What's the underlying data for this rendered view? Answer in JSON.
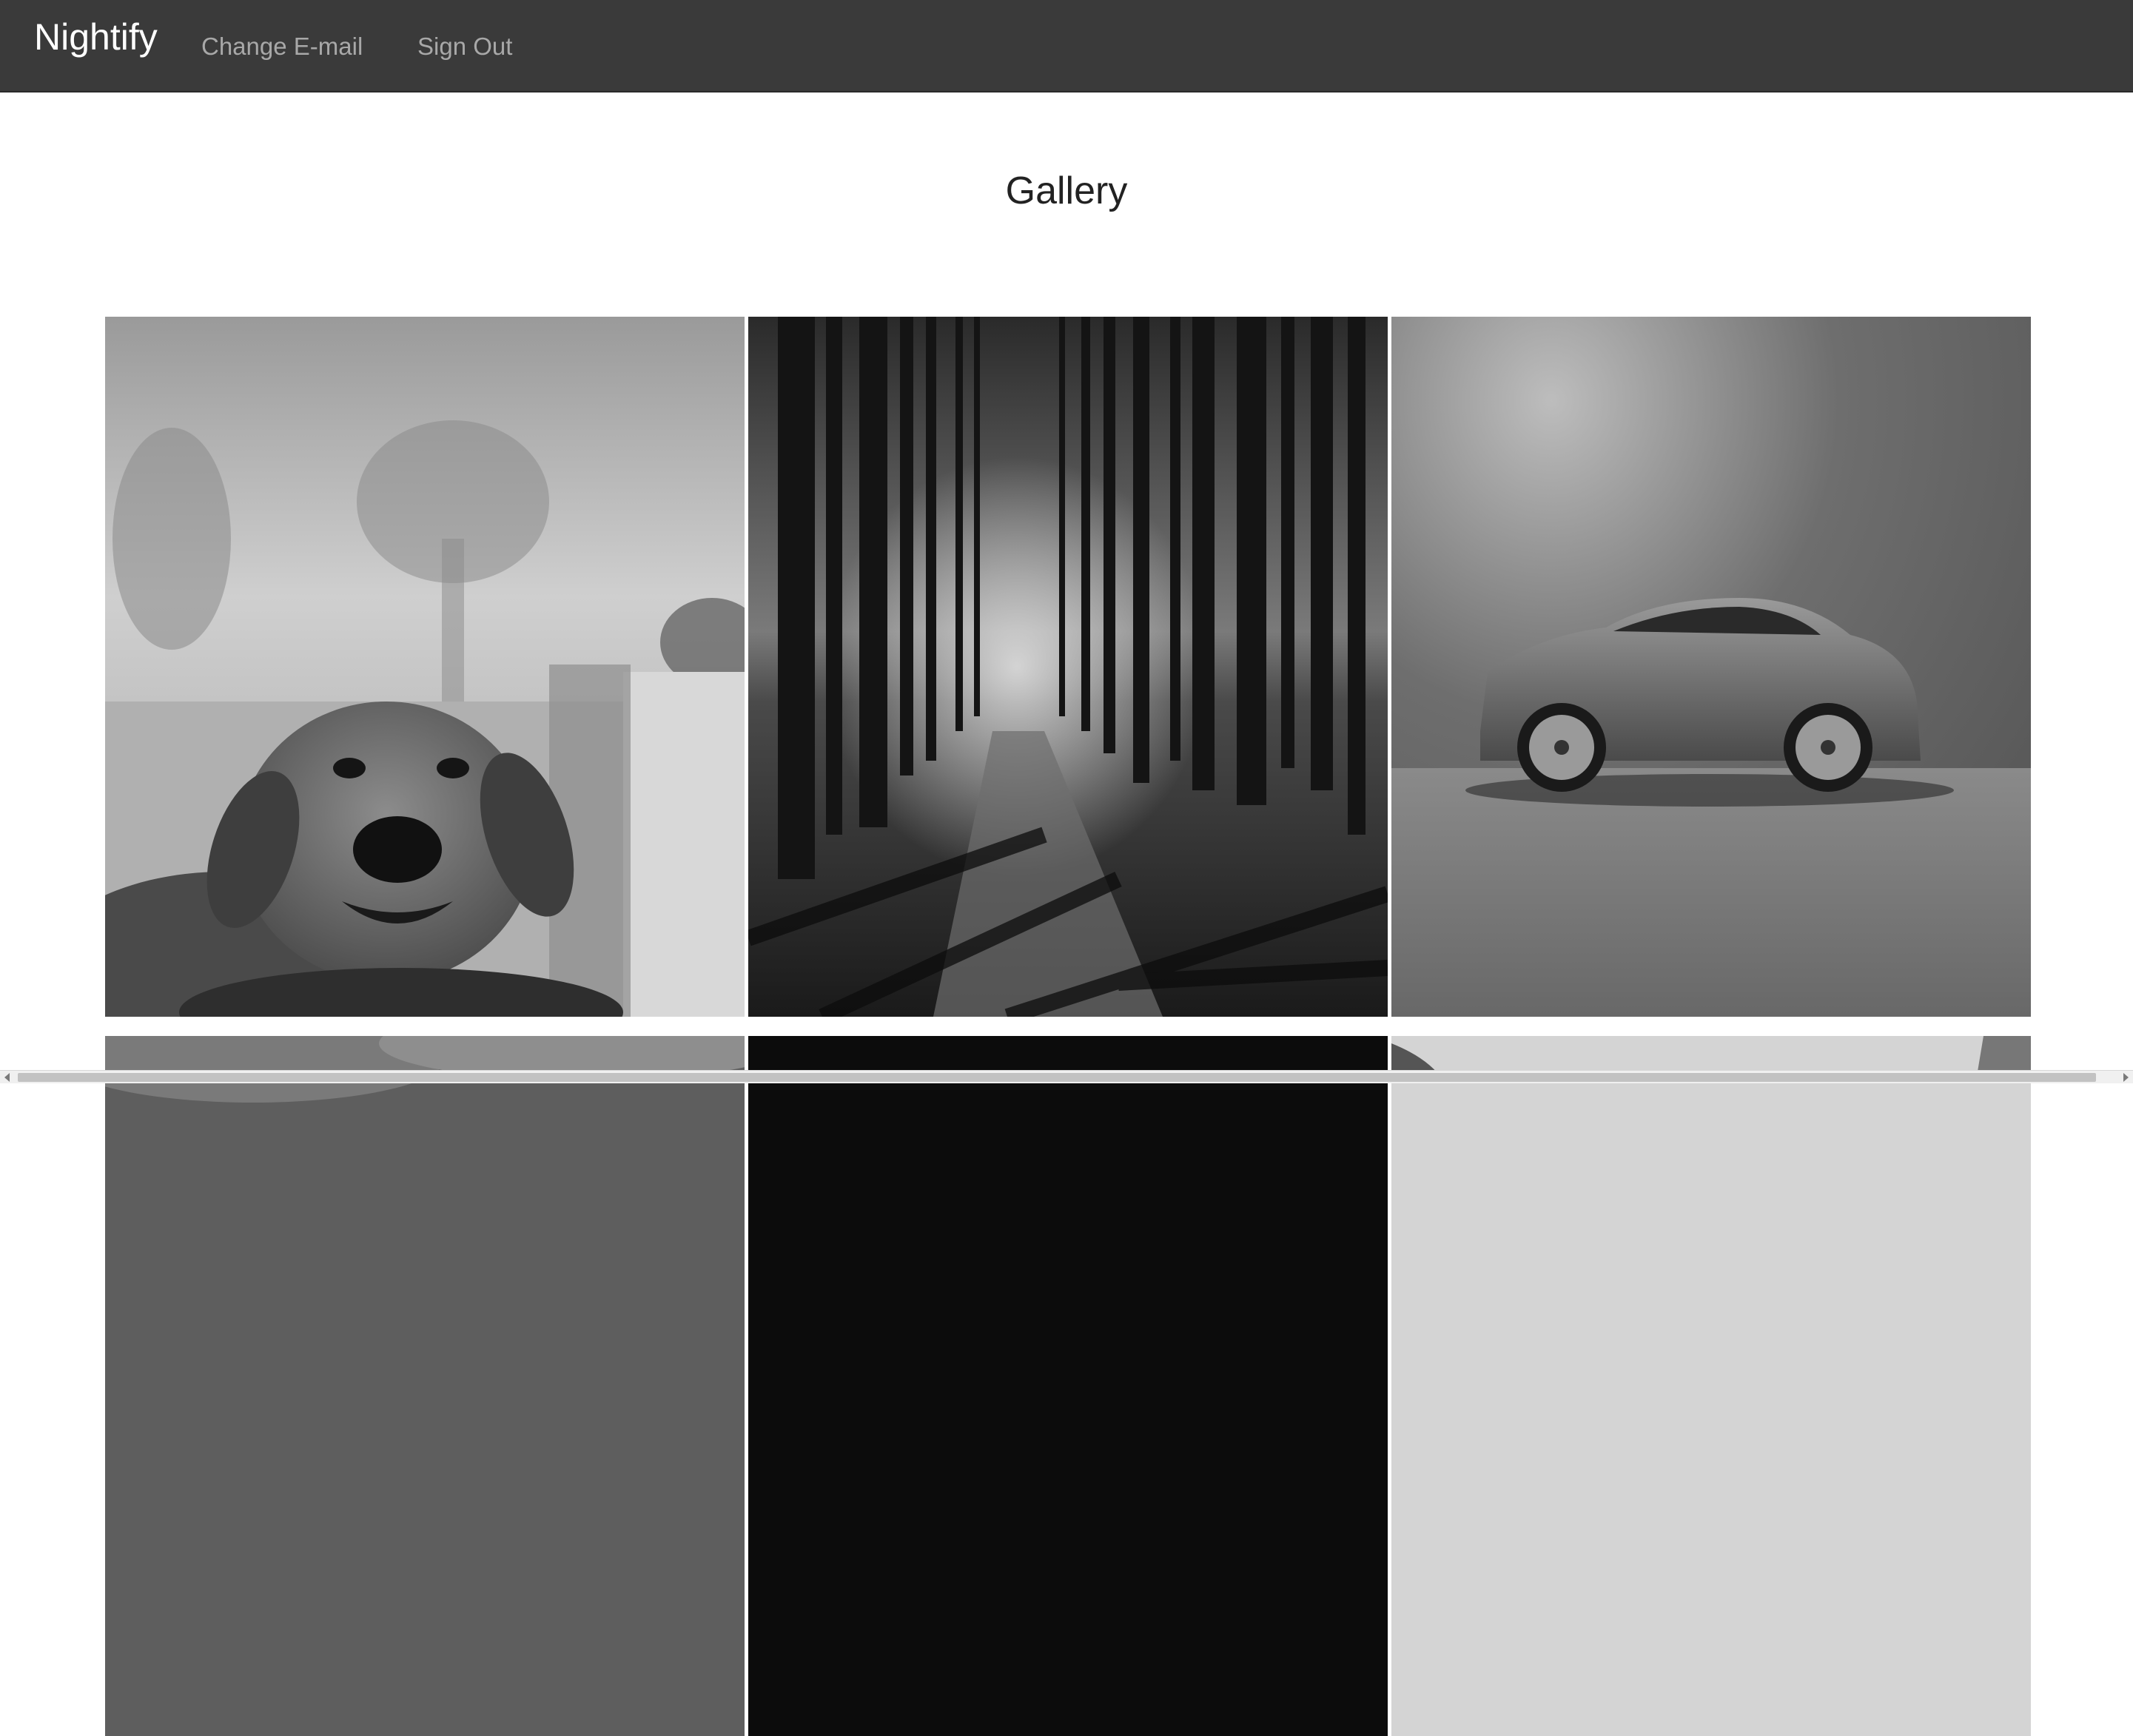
{
  "navbar": {
    "brand": "Nightify",
    "links": [
      {
        "label": "Change E-mail"
      },
      {
        "label": "Sign Out"
      }
    ]
  },
  "page": {
    "title": "Gallery"
  },
  "gallery": {
    "images": [
      {
        "subject": "golden retriever dog portrait, black and white"
      },
      {
        "subject": "forest path with tall trees, black and white"
      },
      {
        "subject": "grey sports car in studio, black and white"
      },
      {
        "subject": "cloudy sky landscape, black and white"
      },
      {
        "subject": "dark night scene, black and white"
      },
      {
        "subject": "rocky cliff scene, black and white"
      }
    ]
  },
  "icons": {
    "scroll_left": "chevron-left-icon",
    "scroll_right": "chevron-right-icon"
  }
}
